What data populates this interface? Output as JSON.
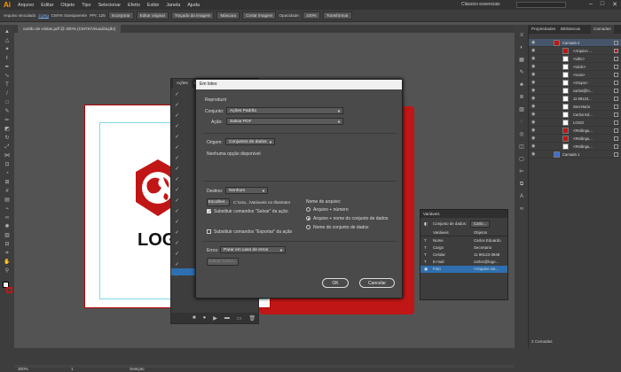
{
  "menubar": {
    "app_logo": "Ai",
    "items": [
      "Arquivo",
      "Editar",
      "Objeto",
      "Tipo",
      "Selecionar",
      "Efeito",
      "Exibir",
      "Janela",
      "Ajuda"
    ],
    "workspace": "Clássico essenciais",
    "window_buttons": [
      "–",
      "□",
      "✕"
    ]
  },
  "control_bar": {
    "selection": "Arquivo vinculado",
    "file": "2.png",
    "color_info": "CMYK transparente",
    "ppi": "PPI: 125",
    "embed": "Incorporar",
    "edit_original": "Editar original",
    "trace": "Traçado da imagem",
    "mask": "Máscara",
    "crop": "Cortar imagem",
    "opacity_label": "Opacidade:",
    "opacity": "100%",
    "transform": "Transformar"
  },
  "document": {
    "tab": "cartão de visitas.pdf @ 300% (CMYK/Visualização)",
    "logo_text": "LOG"
  },
  "actions_panel": {
    "tabs": [
      "Ações",
      "Li..."
    ]
  },
  "dialog": {
    "title": "Em lotes",
    "section_play": "Reproduzir",
    "set_label": "Conjunto:",
    "set_value": "Ações Padrão",
    "action_label": "Ação:",
    "action_value": "Salvar PDF",
    "source_label": "Origem:",
    "source_value": "Conjuntos de dados",
    "no_option": "Nenhuma opção disponível",
    "dest_label": "Destino:",
    "dest_value": "Nenhum",
    "choose_button": "Escolher...",
    "dest_path": "C:\\Usu...\\Variaveis no Illustrator",
    "override_save": "Substituir comandos \"Salvar\" da ação",
    "override_export": "Substituir comandos \"Exportar\" da ação",
    "filename_label": "Nome do arquivo:",
    "radio_1": "Arquivo + número",
    "radio_2": "Arquivo + nome do conjunto de dados",
    "radio_3": "Nome do conjunto de dados",
    "errors_label": "Erros:",
    "errors_value": "Parar em caso de erros",
    "save_as": "Salvar Como...",
    "ok": "OK",
    "cancel": "Cancelar"
  },
  "variables_panel": {
    "title": "Variáveis",
    "dataset_label": "Conjunto de dados:",
    "dataset_value": "Carlo...",
    "col_variable": "Variáveis",
    "col_objects": "Objetos",
    "rows": [
      {
        "type": "T",
        "name": "Nome",
        "object": "Carlos Eduardo"
      },
      {
        "type": "T",
        "name": "Cargo",
        "object": "Secretario"
      },
      {
        "type": "T",
        "name": "Celular",
        "object": "11 99123-3948"
      },
      {
        "type": "T",
        "name": "E-mail",
        "object": "carlos@logo..."
      },
      {
        "type": "▣",
        "name": "Foto",
        "object": "<Arquivo vin..."
      }
    ]
  },
  "layers_panel": {
    "tabs": [
      "Propriedades",
      "Bibliotecas",
      "Camadas"
    ],
    "rows": [
      "Camada 2",
      "<Arquivo ...",
      "<Uiltc>",
      "<Uiolc>",
      "<Uuiu>",
      "<Grupo>",
      "carlos@lo...",
      "11 99123...",
      "Secretario",
      "Carlos Ed...",
      "LOGO",
      "<Retângu...",
      "<Retângu...",
      "<Retângu...",
      "Camada 1"
    ],
    "footer": "2 Camadas"
  },
  "status": {
    "zoom": "300%",
    "page": "1",
    "tool": "Seleção"
  }
}
